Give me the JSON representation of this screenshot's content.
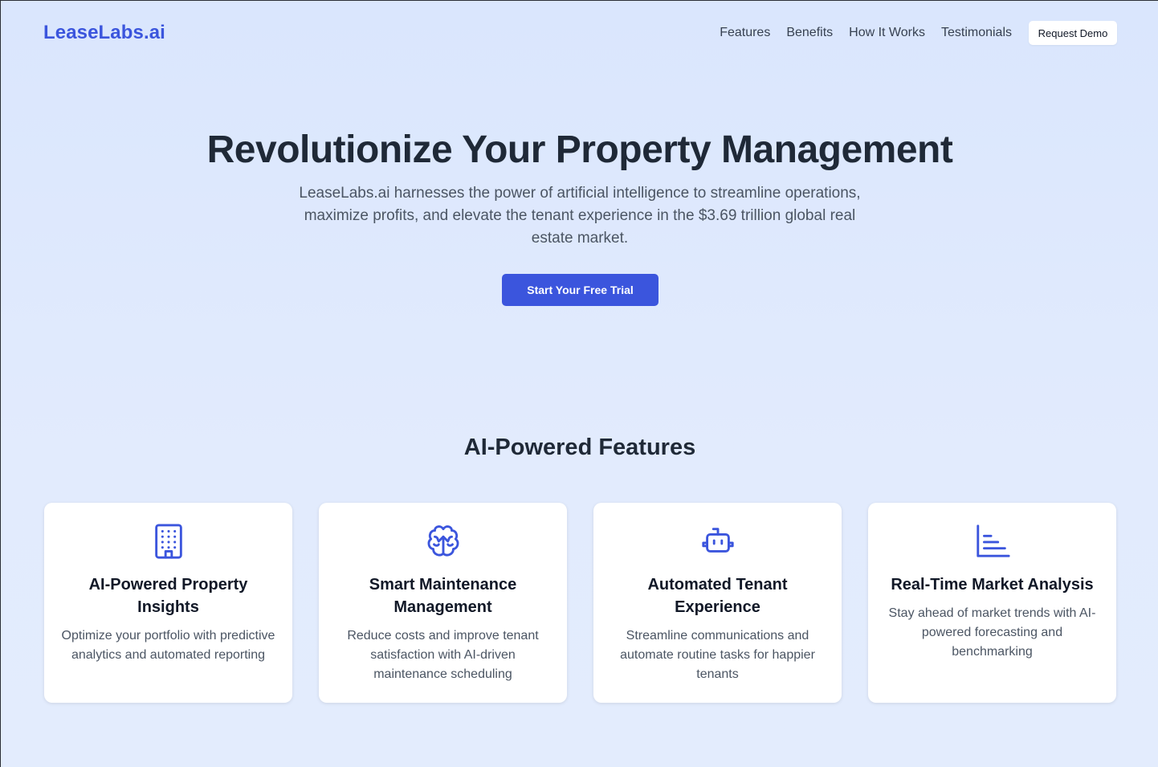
{
  "nav": {
    "logo": "LeaseLabs.ai",
    "links": [
      "Features",
      "Benefits",
      "How It Works",
      "Testimonials"
    ],
    "demo_label": "Request Demo"
  },
  "hero": {
    "title": "Revolutionize Your Property Management",
    "subtitle": "LeaseLabs.ai harnesses the power of artificial intelligence to streamline operations, maximize profits, and elevate the tenant experience in the $3.69 trillion global real estate market.",
    "cta_label": "Start Your Free Trial"
  },
  "features": {
    "title": "AI-Powered Features",
    "cards": [
      {
        "icon": "building-icon",
        "title": "AI-Powered Property Insights",
        "description": "Optimize your portfolio with predictive analytics and automated reporting"
      },
      {
        "icon": "brain-icon",
        "title": "Smart Maintenance Management",
        "description": "Reduce costs and improve tenant satisfaction with AI-driven maintenance scheduling"
      },
      {
        "icon": "robot-icon",
        "title": "Automated Tenant Experience",
        "description": "Streamline communications and automate routine tasks for happier tenants"
      },
      {
        "icon": "bar-chart-icon",
        "title": "Real-Time Market Analysis",
        "description": "Stay ahead of market trends with AI-powered forecasting and benchmarking"
      }
    ]
  },
  "colors": {
    "accent": "#3b55dd",
    "background": "#dae6fd",
    "heading": "#1f2937",
    "body_text": "#4b5563"
  }
}
